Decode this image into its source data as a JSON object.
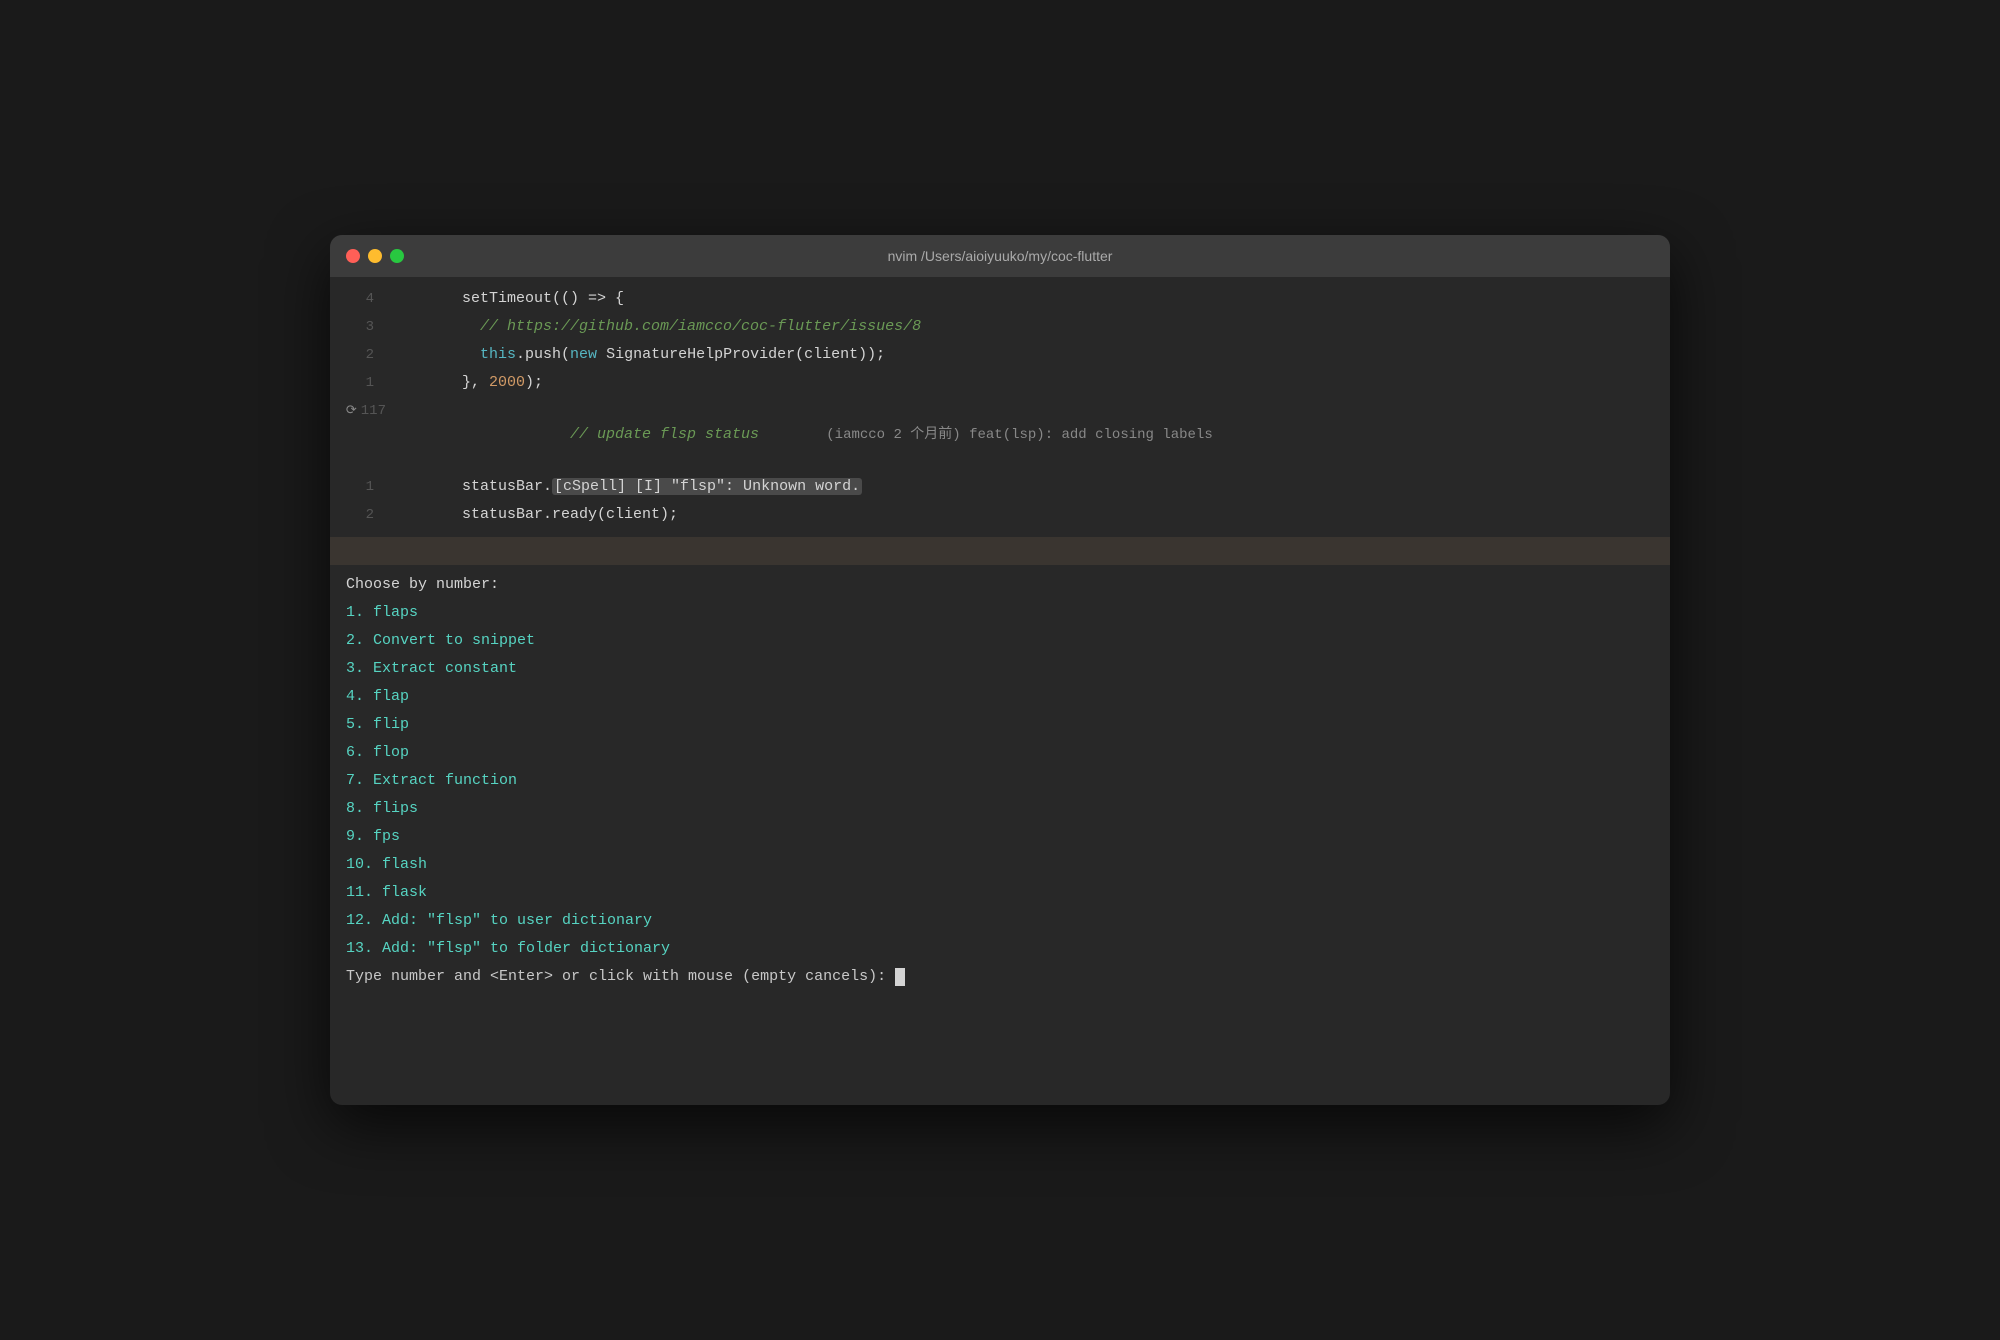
{
  "window": {
    "title": "nvim /Users/aioiyuuko/my/coc-flutter"
  },
  "traffic_lights": {
    "red_label": "close",
    "yellow_label": "minimize",
    "green_label": "maximize"
  },
  "code_lines": [
    {
      "num": "4",
      "parts": [
        {
          "text": "        setTimeout(() => {",
          "class": "c-default"
        }
      ]
    },
    {
      "num": "3",
      "parts": [
        {
          "text": "          // https://github.com/iamcco/coc-flutter/issues/8",
          "class": "c-comment"
        }
      ]
    },
    {
      "num": "2",
      "parts": [
        {
          "text": "          ",
          "class": "c-default"
        },
        {
          "text": "this",
          "class": "c-this"
        },
        {
          "text": ".push(",
          "class": "c-default"
        },
        {
          "text": "new",
          "class": "c-keyword"
        },
        {
          "text": " SignatureHelpProvider(client));",
          "class": "c-default"
        }
      ]
    },
    {
      "num": "1",
      "parts": [
        {
          "text": "        }, ",
          "class": "c-default"
        },
        {
          "text": "2000",
          "class": "c-number"
        },
        {
          "text": ");",
          "class": "c-default"
        }
      ]
    }
  ],
  "git_line": {
    "num": "117",
    "comment": "// update flsp status",
    "git_info": "        (iamcco 2 个月前) feat(lsp): add closing labels"
  },
  "status_lines": [
    {
      "num": "1",
      "before_highlight": "        statusBar.",
      "highlighted": "[cSpell] [I] \"flsp\": Unknown word.",
      "after": ""
    },
    {
      "num": "2",
      "text": "        statusBar.ready(client);"
    }
  ],
  "menu": {
    "header": "Choose by number:",
    "items": [
      {
        "num": "1.",
        "label": "flaps"
      },
      {
        "num": "2.",
        "label": "Convert to snippet"
      },
      {
        "num": "3.",
        "label": "Extract constant"
      },
      {
        "num": "4.",
        "label": "flap"
      },
      {
        "num": "5.",
        "label": "flip"
      },
      {
        "num": "6.",
        "label": "flop"
      },
      {
        "num": "7.",
        "label": "Extract function"
      },
      {
        "num": "8.",
        "label": "flips"
      },
      {
        "num": "9.",
        "label": "fps"
      },
      {
        "num": "10.",
        "label": "flash"
      },
      {
        "num": "11.",
        "label": "flask"
      },
      {
        "num": "12.",
        "label": "Add: \"flsp\" to user dictionary"
      },
      {
        "num": "13.",
        "label": "Add: \"flsp\" to folder dictionary"
      }
    ],
    "prompt": "Type number and <Enter> or click with mouse (empty cancels): "
  }
}
